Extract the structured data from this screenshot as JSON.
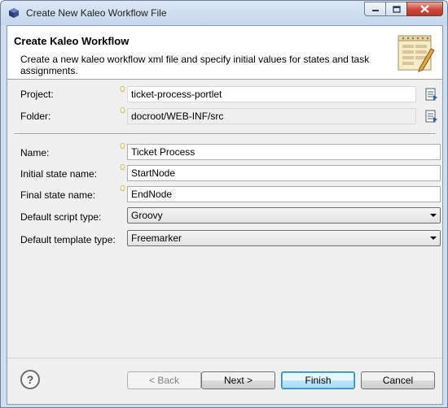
{
  "window": {
    "title": "Create New Kaleo Workflow File",
    "icon": "eclipse-app-icon"
  },
  "banner": {
    "title": "Create Kaleo Workflow",
    "description": "Create a new kaleo workflow xml file and specify initial values for states and task assignments.",
    "icon": "workflow-document-icon"
  },
  "location": {
    "project_label": "Project:",
    "project_value": "ticket-process-portlet",
    "folder_label": "Folder:",
    "folder_value": "docroot/WEB-INF/src"
  },
  "form": {
    "name_label": "Name:",
    "name_value": "Ticket Process",
    "initial_label": "Initial state name:",
    "initial_value": "StartNode",
    "final_label": "Final state name:",
    "final_value": "EndNode",
    "script_label": "Default script type:",
    "script_value": "Groovy",
    "template_label": "Default template type:",
    "template_value": "Freemarker"
  },
  "buttons": {
    "help": "?",
    "back": "< Back",
    "next": "Next >",
    "finish": "Finish",
    "cancel": "Cancel"
  },
  "colors": {
    "accent": "#3c7fb1",
    "titlebar": "#c5d7ec",
    "close": "#c9483a"
  }
}
